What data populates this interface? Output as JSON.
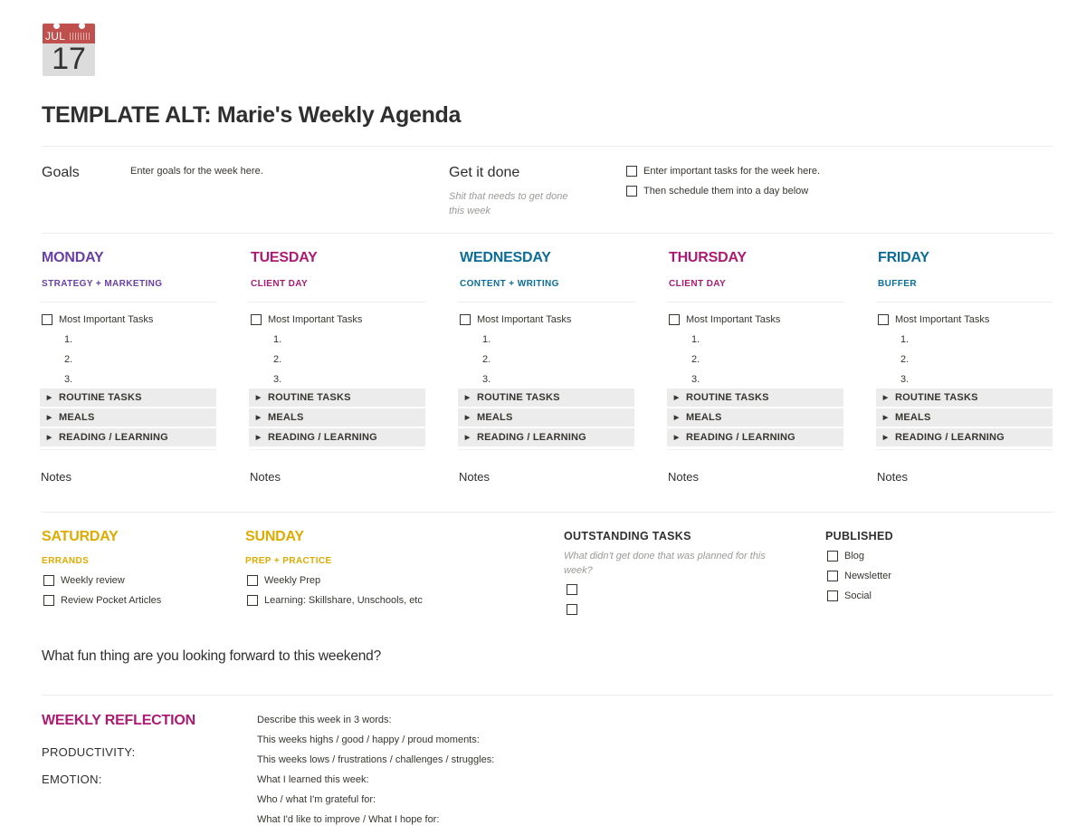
{
  "page": {
    "icon": {
      "name": "calendar-icon",
      "month": "JUL",
      "day": "17"
    },
    "title": "TEMPLATE ALT: Marie's Weekly Agenda"
  },
  "goals": {
    "heading": "Goals",
    "text": "Enter goals for the week here."
  },
  "get_it_done": {
    "heading": "Get it done",
    "subtitle": "Shit that needs to get done this week",
    "tasks": [
      {
        "label": "Enter important tasks for the week here.",
        "checked": false
      },
      {
        "label": "Then schedule them into a day below",
        "checked": false
      }
    ]
  },
  "weekdays": [
    {
      "name": "MONDAY",
      "theme": "STRATEGY + MARKETING",
      "color": "#6940a5",
      "mit_label": "Most Important Tasks",
      "numbered": [
        "1.",
        "2.",
        "3."
      ],
      "toggles": [
        "ROUTINE TASKS",
        "MEALS",
        "READING / LEARNING"
      ],
      "notes_label": "Notes"
    },
    {
      "name": "TUESDAY",
      "theme": "CLIENT DAY",
      "color": "#ad1a72",
      "mit_label": "Most Important Tasks",
      "numbered": [
        "1.",
        "2.",
        "3."
      ],
      "toggles": [
        "ROUTINE TASKS",
        "MEALS",
        "READING / LEARNING"
      ],
      "notes_label": "Notes"
    },
    {
      "name": "WEDNESDAY",
      "theme": "CONTENT + WRITING",
      "color": "#0b6e99",
      "mit_label": "Most Important Tasks",
      "numbered": [
        "1.",
        "2.",
        "3."
      ],
      "toggles": [
        "ROUTINE TASKS",
        "MEALS",
        "READING / LEARNING"
      ],
      "notes_label": "Notes"
    },
    {
      "name": "THURSDAY",
      "theme": "CLIENT DAY",
      "color": "#ad1a72",
      "mit_label": "Most Important Tasks",
      "numbered": [
        "1.",
        "2.",
        "3."
      ],
      "toggles": [
        "ROUTINE TASKS",
        "MEALS",
        "READING / LEARNING"
      ],
      "notes_label": "Notes"
    },
    {
      "name": "FRIDAY",
      "theme": "BUFFER",
      "color": "#0b6e99",
      "mit_label": "Most Important Tasks",
      "numbered": [
        "1.",
        "2.",
        "3."
      ],
      "toggles": [
        "ROUTINE TASKS",
        "MEALS",
        "READING / LEARNING"
      ],
      "notes_label": "Notes"
    }
  ],
  "weekend": [
    {
      "name": "SATURDAY",
      "theme": "ERRANDS",
      "color": "#dfab01",
      "items": [
        "Weekly review",
        "Review Pocket Articles"
      ]
    },
    {
      "name": "SUNDAY",
      "theme": "PREP + PRACTICE",
      "color": "#dfab01",
      "items": [
        "Weekly Prep",
        "Learning: Skillshare, Unschools, etc"
      ]
    }
  ],
  "outstanding": {
    "heading": "OUTSTANDING TASKS",
    "subtitle": "What didn't get done that was planned for this week?",
    "empty_checkboxes": 2
  },
  "published": {
    "heading": "PUBLISHED",
    "items": [
      "Blog",
      "Newsletter",
      "Social"
    ]
  },
  "fun_question": "What fun thing are you looking forward to this weekend?",
  "reflection": {
    "title": "WEEKLY REFLECTION",
    "title_color": "#ad1a72",
    "labels": [
      "PRODUCTIVITY:",
      "EMOTION:"
    ],
    "prompts": [
      "Describe this week in 3 words:",
      "This weeks highs / good / happy / proud moments:",
      "This weeks lows / frustrations / challenges / struggles:",
      "What I learned this week:",
      "Who / what I'm grateful for:",
      "What I'd like to improve / What I hope for:"
    ]
  }
}
